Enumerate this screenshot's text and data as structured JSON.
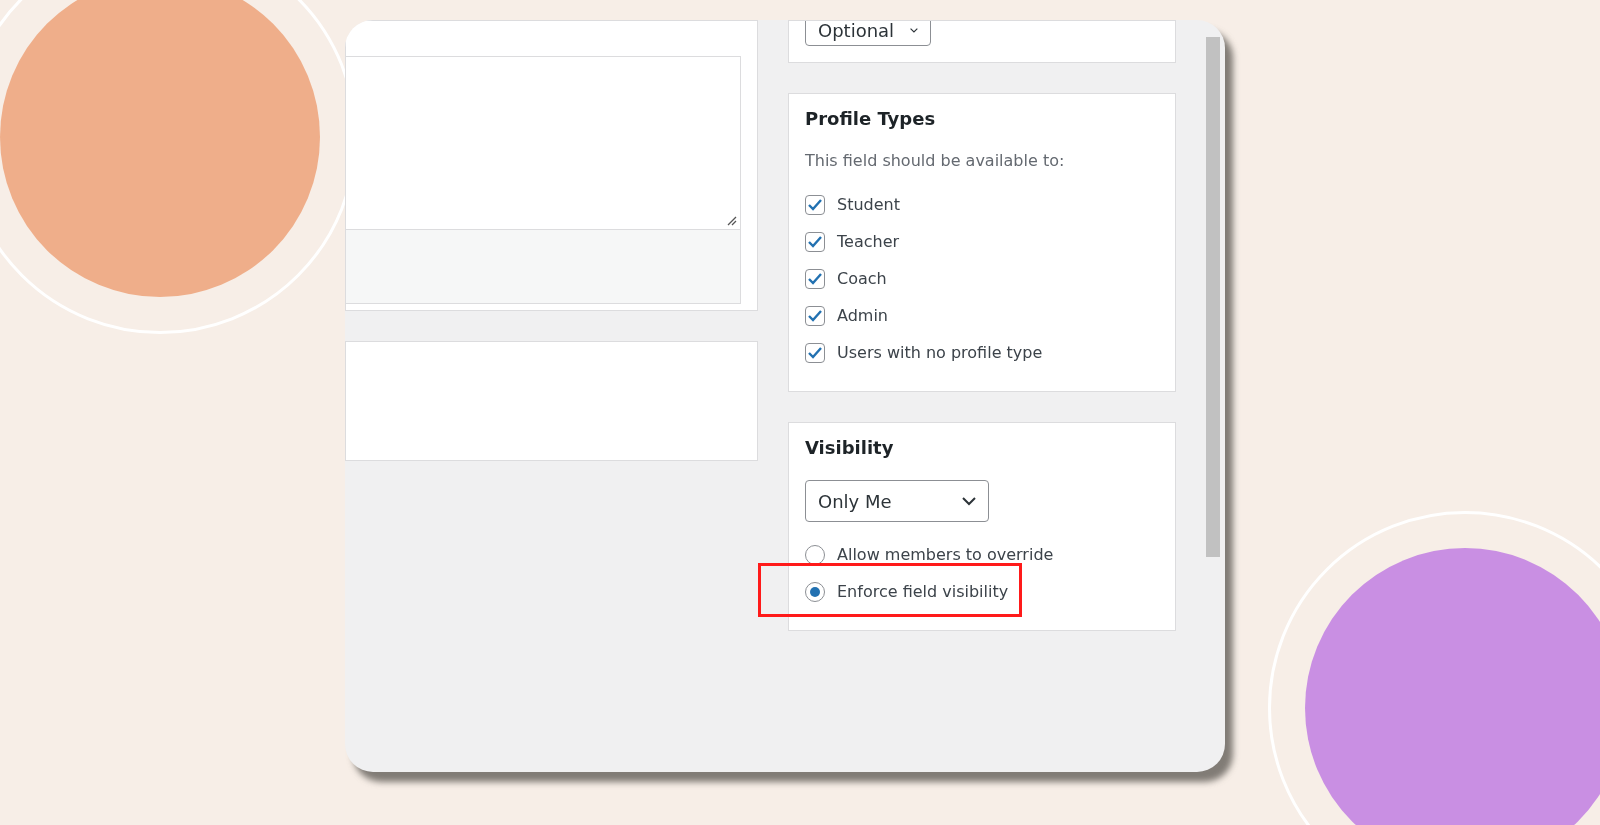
{
  "required_select": {
    "value": "Optional"
  },
  "profile_types": {
    "title": "Profile Types",
    "description": "This field should be available to:",
    "options": [
      {
        "label": "Student",
        "checked": true
      },
      {
        "label": "Teacher",
        "checked": true
      },
      {
        "label": "Coach",
        "checked": true
      },
      {
        "label": "Admin",
        "checked": true
      },
      {
        "label": "Users with no profile type",
        "checked": true
      }
    ]
  },
  "visibility": {
    "title": "Visibility",
    "select": {
      "value": "Only Me"
    },
    "options": [
      {
        "label": "Allow members to override",
        "selected": false,
        "highlighted": false
      },
      {
        "label": "Enforce field visibility",
        "selected": true,
        "highlighted": true
      }
    ]
  }
}
